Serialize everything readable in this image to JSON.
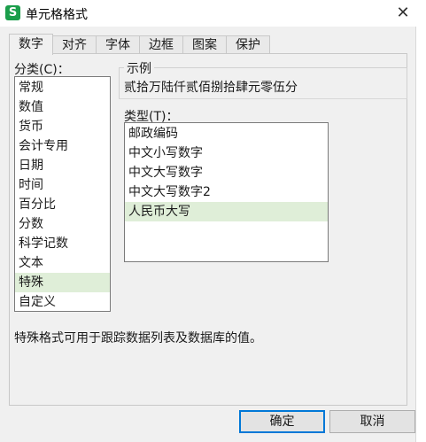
{
  "window": {
    "app_icon_letter": "S",
    "title": "单元格格式",
    "close_glyph": "✕"
  },
  "tabs": [
    {
      "label": "数字",
      "active": true
    },
    {
      "label": "对齐",
      "active": false
    },
    {
      "label": "字体",
      "active": false
    },
    {
      "label": "边框",
      "active": false
    },
    {
      "label": "图案",
      "active": false
    },
    {
      "label": "保护",
      "active": false
    }
  ],
  "category": {
    "label": "分类(C)：",
    "items": [
      "常规",
      "数值",
      "货币",
      "会计专用",
      "日期",
      "时间",
      "百分比",
      "分数",
      "科学记数",
      "文本",
      "特殊",
      "自定义"
    ],
    "selected": "特殊"
  },
  "sample": {
    "legend": "示例",
    "value": "贰拾万陆仟贰佰捌拾肆元零伍分"
  },
  "type": {
    "label": "类型(T)：",
    "items": [
      "邮政编码",
      "中文小写数字",
      "中文大写数字",
      "中文大写数字2",
      "人民币大写"
    ],
    "selected": "人民币大写"
  },
  "description": "特殊格式可用于跟踪数据列表及数据库的值。",
  "buttons": {
    "ok": "确定",
    "cancel": "取消"
  },
  "colors": {
    "selection": "#dfeed8",
    "app_icon": "#1b9e4b",
    "default_button_border": "#0078d7"
  }
}
